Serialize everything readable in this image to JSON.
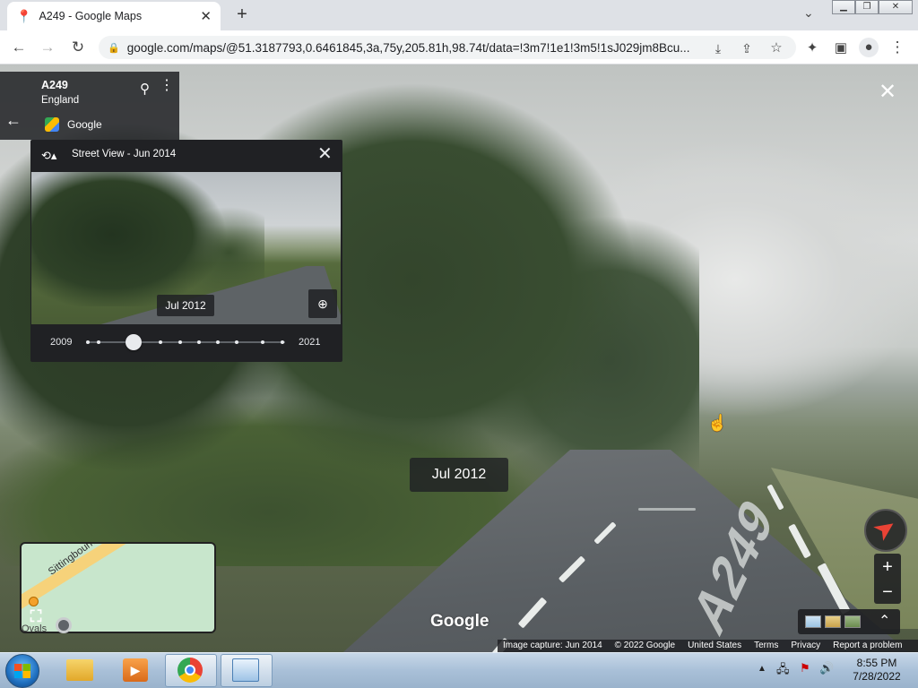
{
  "browser": {
    "tab_title": "A249 - Google Maps",
    "tab_close": "✕",
    "new_tab": "+",
    "tab_search": "⌄",
    "url": "google.com/maps/@51.3187793,0.6461845,3a,75y,205.81h,98.74t/data=!3m7!1e1!3m5!1sJ029jm8Bcu..."
  },
  "place": {
    "name": "A249",
    "region": "England",
    "source": "Google"
  },
  "time_machine": {
    "header": "Street View - Jun 2014",
    "thumb_date": "Jul 2012",
    "start_year": "2009",
    "end_year": "2021",
    "selected_fraction": 0.24
  },
  "street_view": {
    "date_overlay": "Jul 2012",
    "road_marking": "A249",
    "logo": "Google"
  },
  "minimap": {
    "road_label": "Sittingbourne Rd",
    "corner_text": "Ovals"
  },
  "attribution": {
    "capture": "Image capture: Jun 2014",
    "copyright": "© 2022 Google",
    "country": "United States",
    "terms": "Terms",
    "privacy": "Privacy",
    "report": "Report a problem"
  },
  "taskbar": {
    "time": "8:55 PM",
    "date": "7/28/2022"
  },
  "colors": {
    "panel_bg": "#202124",
    "compass_red": "#ea4335",
    "taskbar": "#a9c0d8"
  }
}
